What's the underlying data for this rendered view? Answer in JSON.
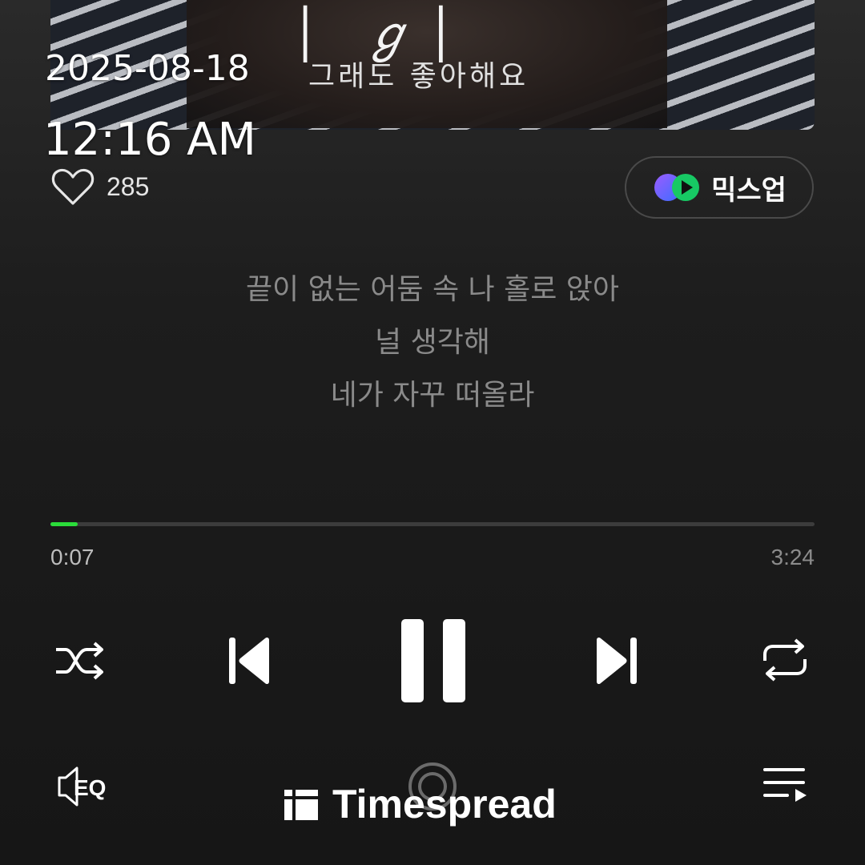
{
  "album_art": {
    "script_title": "│ ℊ│",
    "subtitle": "그래도 좋아해요"
  },
  "timestamp": {
    "date": "2025-08-18",
    "time": "12:16 AM"
  },
  "like": {
    "icon": "heart-outline-icon",
    "count": "285"
  },
  "mixup": {
    "icon": "mixup-logo-icon",
    "label": "믹스업",
    "colors": [
      "#7b4dff",
      "#17c964",
      "#2bdc3a"
    ]
  },
  "lyrics": [
    "끝이 없는 어둠 속 나 홀로 앉아",
    "널 생각해",
    "네가 자꾸 떠올라"
  ],
  "progress": {
    "elapsed": "0:07",
    "total": "3:24",
    "fraction": 0.036,
    "accent": "#2bdc3a"
  },
  "controls": {
    "shuffle": "shuffle-icon",
    "previous": "previous-track-icon",
    "play_state": "pause-icon",
    "next": "next-track-icon",
    "repeat": "repeat-icon"
  },
  "bottom": {
    "eq_label": "EQ",
    "cast": "cast-icon",
    "queue": "playlist-queue-icon"
  },
  "watermark": {
    "text": "Timespread"
  }
}
